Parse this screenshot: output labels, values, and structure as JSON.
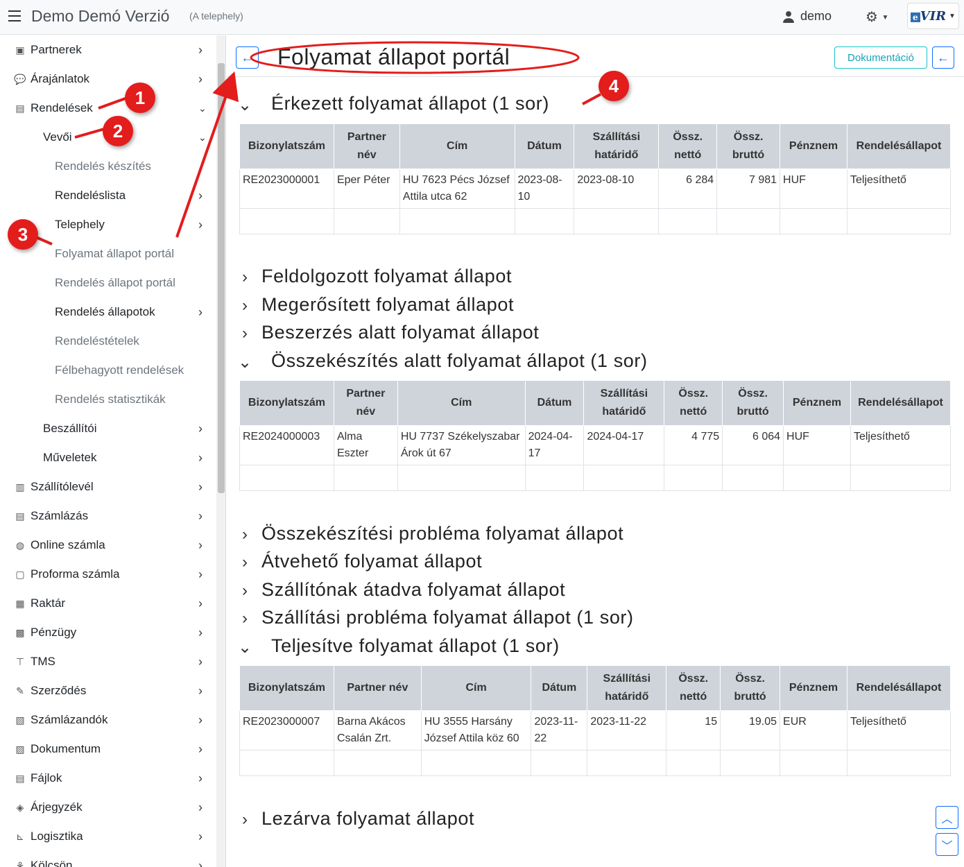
{
  "header": {
    "title": "Demo Demó Verzió",
    "subtitle": "(A telephely)",
    "user": "demo",
    "logo_text": "VIR",
    "logo_prefix": "e"
  },
  "sidebar": {
    "items": [
      {
        "label": "Partnerek",
        "icon": "address-card-icon"
      },
      {
        "label": "Árajánlatok",
        "icon": "comments-icon"
      },
      {
        "label": "Rendelések",
        "icon": "file-icon"
      },
      {
        "label": "Vevői"
      },
      {
        "label": "Rendelés készítés"
      },
      {
        "label": "Rendeléslista"
      },
      {
        "label": "Telephely"
      },
      {
        "label": "Folyamat állapot portál"
      },
      {
        "label": "Rendelés állapot portál"
      },
      {
        "label": "Rendelés állapotok"
      },
      {
        "label": "Rendeléstételek"
      },
      {
        "label": "Félbehagyott rendelések"
      },
      {
        "label": "Rendelés statisztikák"
      },
      {
        "label": "Beszállítói"
      },
      {
        "label": "Műveletek"
      },
      {
        "label": "Szállítólevél",
        "icon": "clipboard-icon"
      },
      {
        "label": "Számlázás",
        "icon": "invoice-icon"
      },
      {
        "label": "Online számla",
        "icon": "globe-icon"
      },
      {
        "label": "Proforma számla",
        "icon": "note-icon"
      },
      {
        "label": "Raktár",
        "icon": "warehouse-icon"
      },
      {
        "label": "Pénzügy",
        "icon": "money-icon"
      },
      {
        "label": "TMS",
        "icon": "pin-icon"
      },
      {
        "label": "Szerződés",
        "icon": "signature-icon"
      },
      {
        "label": "Számlázandók",
        "icon": "files-icon"
      },
      {
        "label": "Dokumentum",
        "icon": "word-file-icon"
      },
      {
        "label": "Fájlok",
        "icon": "file-upload-icon"
      },
      {
        "label": "Árjegyzék",
        "icon": "tags-icon"
      },
      {
        "label": "Logisztika",
        "icon": "dolly-icon"
      },
      {
        "label": "Kölcsön",
        "icon": "hand-holding-icon"
      }
    ]
  },
  "page": {
    "title": "Folyamat állapot portál",
    "doc_button": "Dokumentáció"
  },
  "sections": [
    {
      "title": "Érkezett folyamat állapot (1 sor)"
    },
    {
      "title": "Feldolgozott folyamat állapot"
    },
    {
      "title": "Megerősített folyamat állapot"
    },
    {
      "title": "Beszerzés alatt folyamat állapot"
    },
    {
      "title": "Összekészítés alatt folyamat állapot (1 sor)"
    },
    {
      "title": "Összekészítési probléma folyamat állapot"
    },
    {
      "title": "Átvehető folyamat állapot"
    },
    {
      "title": "Szállítónak átadva folyamat állapot"
    },
    {
      "title": "Szállítási probléma folyamat állapot (1 sor)"
    },
    {
      "title": "Teljesítve folyamat állapot (1 sor)"
    },
    {
      "title": "Lezárva folyamat állapot"
    }
  ],
  "table_headers": {
    "doc_no": "Bizonylatszám",
    "partner": "Partner név",
    "address": "Cím",
    "date": "Dátum",
    "deadline": "Szállítási határidő",
    "net": "Össz. nettó",
    "gross": "Össz. bruttó",
    "currency": "Pénznem",
    "status": "Rendelésállapot"
  },
  "tables": {
    "received": {
      "doc_no": "RE2023000001",
      "partner": "Eper Péter",
      "address": "HU 7623 Pécs József Attila utca 62",
      "date": "2023-08-10",
      "deadline": "2023-08-10",
      "net": "6 284",
      "gross": "7 981",
      "currency": "HUF",
      "status": "Teljesíthető"
    },
    "picking": {
      "doc_no": "RE2024000003",
      "partner": "Alma Eszter",
      "address": "HU 7737 Székelyszabar Árok út 67",
      "date": "2024-04-17",
      "deadline": "2024-04-17",
      "net": "4 775",
      "gross": "6 064",
      "currency": "HUF",
      "status": "Teljesíthető"
    },
    "completed": {
      "doc_no": "RE2023000007",
      "partner": "Barna Akácos Csalán Zrt.",
      "address": "HU 3555 Harsány József Attila köz 60",
      "date": "2023-11-22",
      "deadline": "2023-11-22",
      "net": "15",
      "gross": "19.05",
      "currency": "EUR",
      "status": "Teljesíthető"
    }
  },
  "annotations": {
    "b1": "1",
    "b2": "2",
    "b3": "3",
    "b4": "4"
  },
  "colors": {
    "accent": "#0d6efd",
    "annotation": "#e31c1c",
    "table_header": "#ced4da",
    "doc_button": "#17a2b8"
  }
}
